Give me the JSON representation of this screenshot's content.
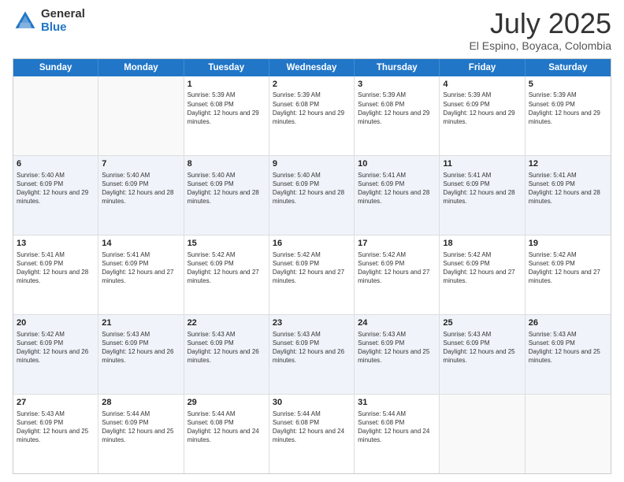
{
  "header": {
    "logo_general": "General",
    "logo_blue": "Blue",
    "title": "July 2025",
    "subtitle": "El Espino, Boyaca, Colombia"
  },
  "calendar": {
    "days": [
      "Sunday",
      "Monday",
      "Tuesday",
      "Wednesday",
      "Thursday",
      "Friday",
      "Saturday"
    ],
    "weeks": [
      [
        {
          "day": "",
          "sunrise": "",
          "sunset": "",
          "daylight": "",
          "empty": true
        },
        {
          "day": "",
          "sunrise": "",
          "sunset": "",
          "daylight": "",
          "empty": true
        },
        {
          "day": "1",
          "sunrise": "Sunrise: 5:39 AM",
          "sunset": "Sunset: 6:08 PM",
          "daylight": "Daylight: 12 hours and 29 minutes.",
          "empty": false
        },
        {
          "day": "2",
          "sunrise": "Sunrise: 5:39 AM",
          "sunset": "Sunset: 6:08 PM",
          "daylight": "Daylight: 12 hours and 29 minutes.",
          "empty": false
        },
        {
          "day": "3",
          "sunrise": "Sunrise: 5:39 AM",
          "sunset": "Sunset: 6:08 PM",
          "daylight": "Daylight: 12 hours and 29 minutes.",
          "empty": false
        },
        {
          "day": "4",
          "sunrise": "Sunrise: 5:39 AM",
          "sunset": "Sunset: 6:09 PM",
          "daylight": "Daylight: 12 hours and 29 minutes.",
          "empty": false
        },
        {
          "day": "5",
          "sunrise": "Sunrise: 5:39 AM",
          "sunset": "Sunset: 6:09 PM",
          "daylight": "Daylight: 12 hours and 29 minutes.",
          "empty": false
        }
      ],
      [
        {
          "day": "6",
          "sunrise": "Sunrise: 5:40 AM",
          "sunset": "Sunset: 6:09 PM",
          "daylight": "Daylight: 12 hours and 29 minutes.",
          "empty": false
        },
        {
          "day": "7",
          "sunrise": "Sunrise: 5:40 AM",
          "sunset": "Sunset: 6:09 PM",
          "daylight": "Daylight: 12 hours and 28 minutes.",
          "empty": false
        },
        {
          "day": "8",
          "sunrise": "Sunrise: 5:40 AM",
          "sunset": "Sunset: 6:09 PM",
          "daylight": "Daylight: 12 hours and 28 minutes.",
          "empty": false
        },
        {
          "day": "9",
          "sunrise": "Sunrise: 5:40 AM",
          "sunset": "Sunset: 6:09 PM",
          "daylight": "Daylight: 12 hours and 28 minutes.",
          "empty": false
        },
        {
          "day": "10",
          "sunrise": "Sunrise: 5:41 AM",
          "sunset": "Sunset: 6:09 PM",
          "daylight": "Daylight: 12 hours and 28 minutes.",
          "empty": false
        },
        {
          "day": "11",
          "sunrise": "Sunrise: 5:41 AM",
          "sunset": "Sunset: 6:09 PM",
          "daylight": "Daylight: 12 hours and 28 minutes.",
          "empty": false
        },
        {
          "day": "12",
          "sunrise": "Sunrise: 5:41 AM",
          "sunset": "Sunset: 6:09 PM",
          "daylight": "Daylight: 12 hours and 28 minutes.",
          "empty": false
        }
      ],
      [
        {
          "day": "13",
          "sunrise": "Sunrise: 5:41 AM",
          "sunset": "Sunset: 6:09 PM",
          "daylight": "Daylight: 12 hours and 28 minutes.",
          "empty": false
        },
        {
          "day": "14",
          "sunrise": "Sunrise: 5:41 AM",
          "sunset": "Sunset: 6:09 PM",
          "daylight": "Daylight: 12 hours and 27 minutes.",
          "empty": false
        },
        {
          "day": "15",
          "sunrise": "Sunrise: 5:42 AM",
          "sunset": "Sunset: 6:09 PM",
          "daylight": "Daylight: 12 hours and 27 minutes.",
          "empty": false
        },
        {
          "day": "16",
          "sunrise": "Sunrise: 5:42 AM",
          "sunset": "Sunset: 6:09 PM",
          "daylight": "Daylight: 12 hours and 27 minutes.",
          "empty": false
        },
        {
          "day": "17",
          "sunrise": "Sunrise: 5:42 AM",
          "sunset": "Sunset: 6:09 PM",
          "daylight": "Daylight: 12 hours and 27 minutes.",
          "empty": false
        },
        {
          "day": "18",
          "sunrise": "Sunrise: 5:42 AM",
          "sunset": "Sunset: 6:09 PM",
          "daylight": "Daylight: 12 hours and 27 minutes.",
          "empty": false
        },
        {
          "day": "19",
          "sunrise": "Sunrise: 5:42 AM",
          "sunset": "Sunset: 6:09 PM",
          "daylight": "Daylight: 12 hours and 27 minutes.",
          "empty": false
        }
      ],
      [
        {
          "day": "20",
          "sunrise": "Sunrise: 5:42 AM",
          "sunset": "Sunset: 6:09 PM",
          "daylight": "Daylight: 12 hours and 26 minutes.",
          "empty": false
        },
        {
          "day": "21",
          "sunrise": "Sunrise: 5:43 AM",
          "sunset": "Sunset: 6:09 PM",
          "daylight": "Daylight: 12 hours and 26 minutes.",
          "empty": false
        },
        {
          "day": "22",
          "sunrise": "Sunrise: 5:43 AM",
          "sunset": "Sunset: 6:09 PM",
          "daylight": "Daylight: 12 hours and 26 minutes.",
          "empty": false
        },
        {
          "day": "23",
          "sunrise": "Sunrise: 5:43 AM",
          "sunset": "Sunset: 6:09 PM",
          "daylight": "Daylight: 12 hours and 26 minutes.",
          "empty": false
        },
        {
          "day": "24",
          "sunrise": "Sunrise: 5:43 AM",
          "sunset": "Sunset: 6:09 PM",
          "daylight": "Daylight: 12 hours and 25 minutes.",
          "empty": false
        },
        {
          "day": "25",
          "sunrise": "Sunrise: 5:43 AM",
          "sunset": "Sunset: 6:09 PM",
          "daylight": "Daylight: 12 hours and 25 minutes.",
          "empty": false
        },
        {
          "day": "26",
          "sunrise": "Sunrise: 5:43 AM",
          "sunset": "Sunset: 6:09 PM",
          "daylight": "Daylight: 12 hours and 25 minutes.",
          "empty": false
        }
      ],
      [
        {
          "day": "27",
          "sunrise": "Sunrise: 5:43 AM",
          "sunset": "Sunset: 6:09 PM",
          "daylight": "Daylight: 12 hours and 25 minutes.",
          "empty": false
        },
        {
          "day": "28",
          "sunrise": "Sunrise: 5:44 AM",
          "sunset": "Sunset: 6:09 PM",
          "daylight": "Daylight: 12 hours and 25 minutes.",
          "empty": false
        },
        {
          "day": "29",
          "sunrise": "Sunrise: 5:44 AM",
          "sunset": "Sunset: 6:08 PM",
          "daylight": "Daylight: 12 hours and 24 minutes.",
          "empty": false
        },
        {
          "day": "30",
          "sunrise": "Sunrise: 5:44 AM",
          "sunset": "Sunset: 6:08 PM",
          "daylight": "Daylight: 12 hours and 24 minutes.",
          "empty": false
        },
        {
          "day": "31",
          "sunrise": "Sunrise: 5:44 AM",
          "sunset": "Sunset: 6:08 PM",
          "daylight": "Daylight: 12 hours and 24 minutes.",
          "empty": false
        },
        {
          "day": "",
          "sunrise": "",
          "sunset": "",
          "daylight": "",
          "empty": true
        },
        {
          "day": "",
          "sunrise": "",
          "sunset": "",
          "daylight": "",
          "empty": true
        }
      ]
    ]
  }
}
